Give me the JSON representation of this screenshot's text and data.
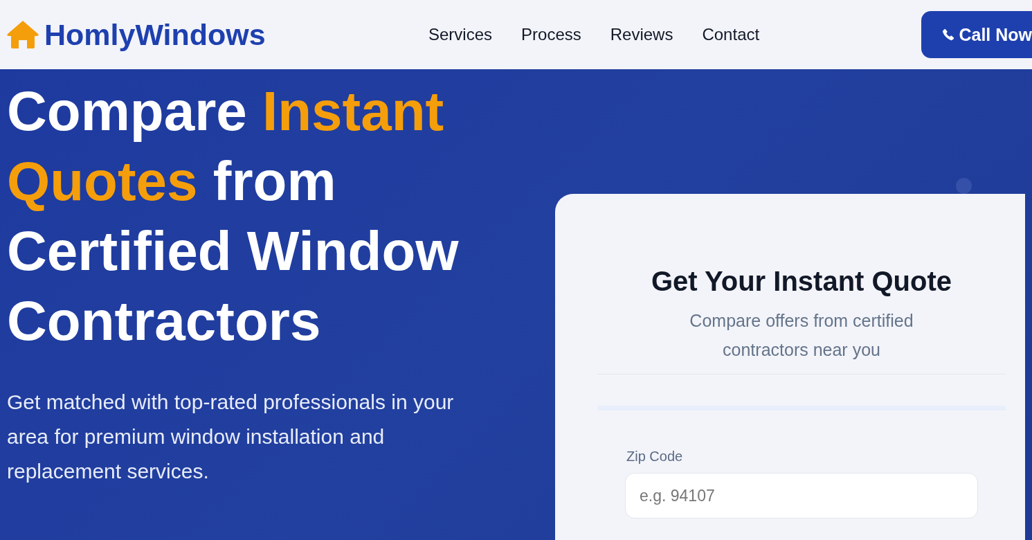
{
  "header": {
    "brand": "HomlyWindows",
    "nav": [
      "Services",
      "Process",
      "Reviews",
      "Contact"
    ],
    "cta": "Call Now"
  },
  "hero": {
    "heading": [
      {
        "text": "Compare ",
        "highlight": false
      },
      {
        "text": "Instant Quotes",
        "highlight": true
      },
      {
        "text": " from Certified Window Contractors",
        "highlight": false
      }
    ],
    "subtitle": "Get matched with top-rated professionals in your area for premium window installation and replacement services."
  },
  "quote_card": {
    "title": "Get Your Instant Quote",
    "subtitle": "Compare offers from certified contractors near you",
    "zip_label": "Zip Code",
    "zip_placeholder": "e.g. 94107"
  }
}
